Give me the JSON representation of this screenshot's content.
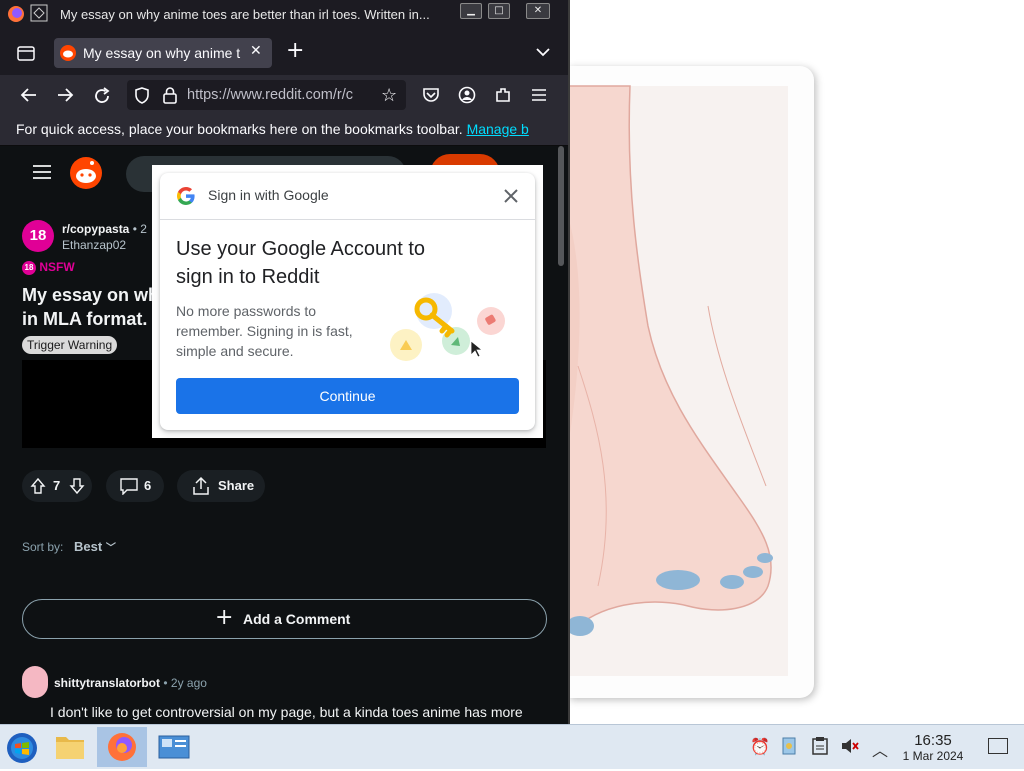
{
  "window": {
    "title": "My essay on why anime toes are better than irl toes. Written in..."
  },
  "tab": {
    "label": "My essay on why anime t"
  },
  "nav": {
    "url": "https://www.reddit.com/r/c"
  },
  "bookmarks_bar": {
    "message": "For quick access, place your bookmarks here on the bookmarks toolbar.",
    "manage_link": "Manage b"
  },
  "post": {
    "subreddit": "r/copypasta",
    "age_fragment": "• 2",
    "author": "Ethanzap02",
    "nsfw_label": "NSFW",
    "title_line1": "My essay on wh",
    "title_line2": "in MLA format.",
    "flair": "Trigger Warning",
    "avatar_text": "18",
    "votes": "7",
    "comments": "6",
    "share_label": "Share"
  },
  "comments_section": {
    "sort_label": "Sort by:",
    "sort_value": "Best",
    "add_comment": "Add a Comment",
    "first_comment": {
      "author": "shittytranslatorbot",
      "age": "• 2y ago",
      "text": "I don't like to get controversial on my page, but a kinda toes anime has more"
    }
  },
  "modal": {
    "header": "Sign in with Google",
    "heading": "Use your Google Account to sign in to Reddit",
    "subtext": "No more passwords to remember. Signing in is fast, simple and secure.",
    "continue_label": "Continue"
  },
  "taskbar": {
    "time": "16:35",
    "date": "1 Mar 2024"
  },
  "colors": {
    "reddit_orange": "#ff4500",
    "nsfw_pink": "#e00096",
    "google_blue": "#1a73e8",
    "firefox_dark": "#1c1b22"
  }
}
